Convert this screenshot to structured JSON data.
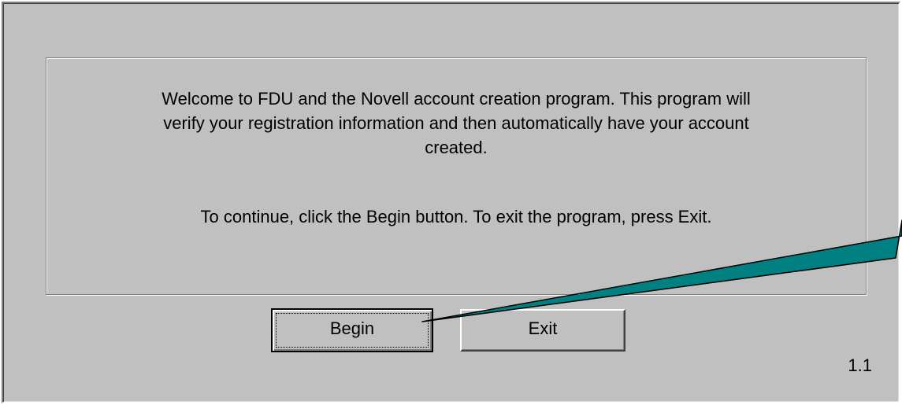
{
  "dialog": {
    "welcome_lines": [
      "Welcome to FDU and the Novell account creation program.  This program will",
      "verify your registration information and then automatically have your account",
      "created."
    ],
    "instruction": "To continue, click the Begin button.  To exit the program, press Exit.",
    "begin_label": "Begin",
    "exit_label": "Exit",
    "version": "1.1"
  },
  "callout": {
    "color": "#008080",
    "target": "begin-button"
  }
}
